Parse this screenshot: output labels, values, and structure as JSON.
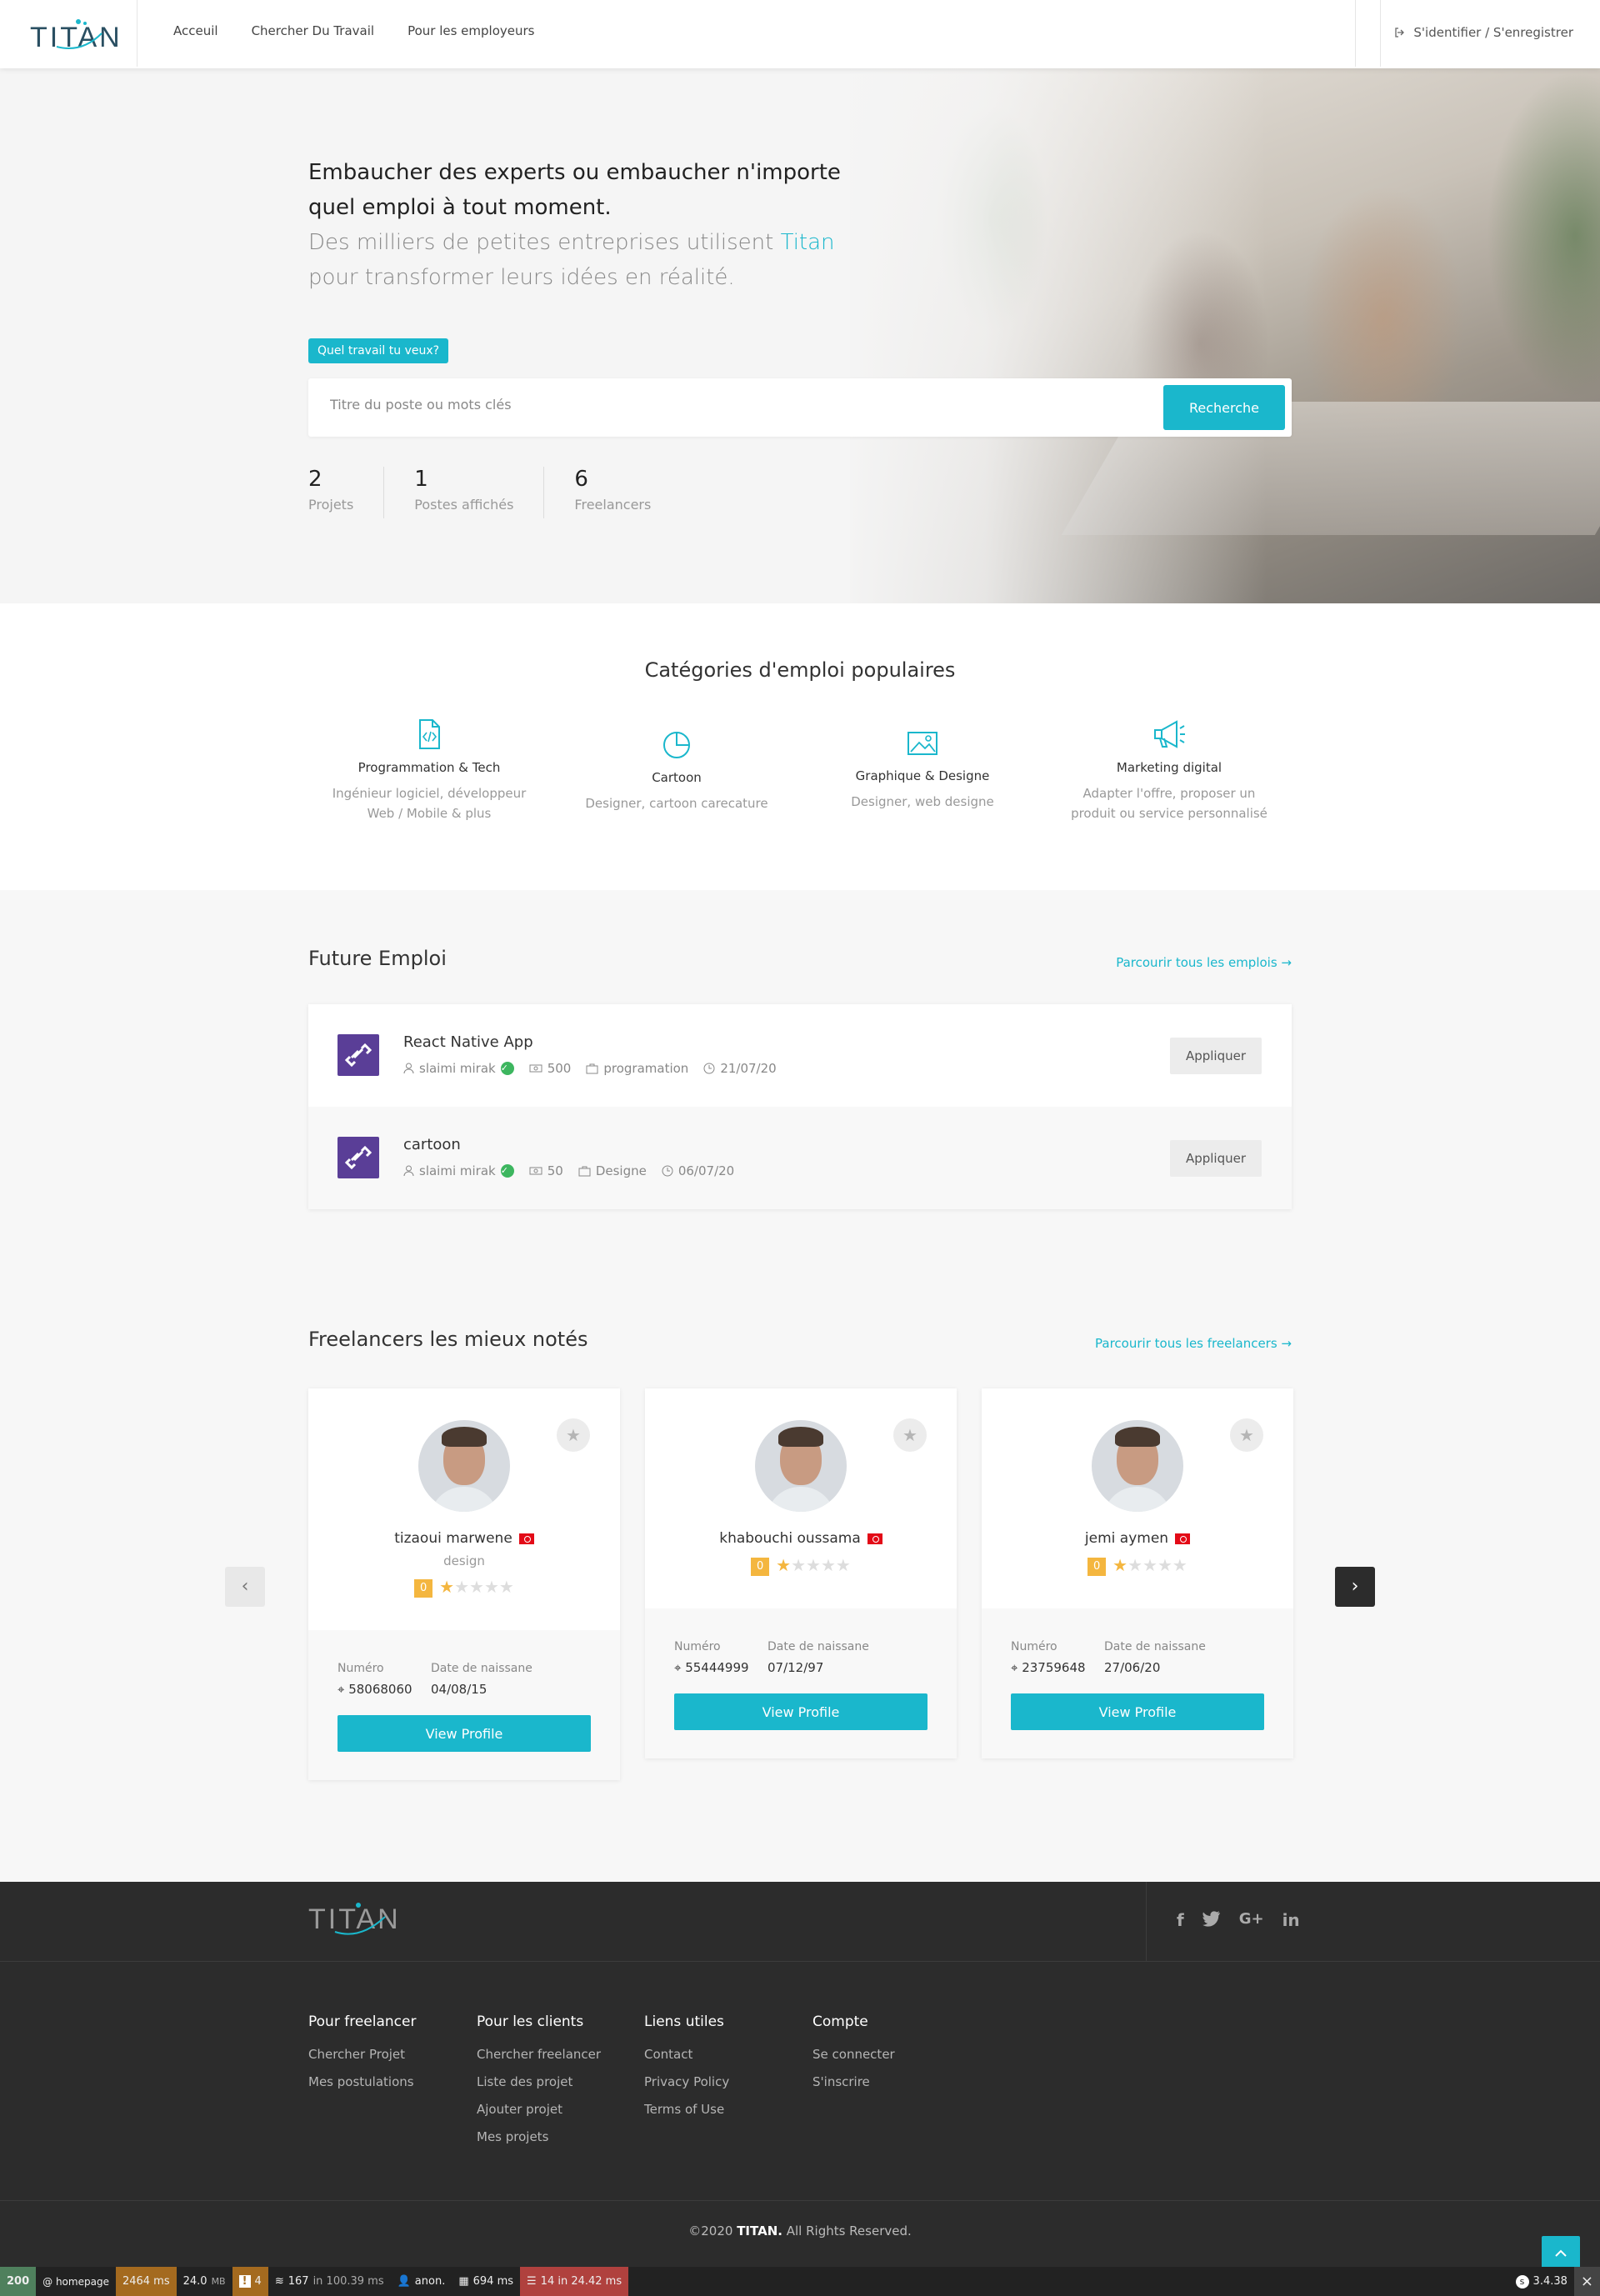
{
  "header": {
    "logo_text": "TITAN",
    "nav": [
      "Acceuil",
      "Chercher Du Travail",
      "Pour les employeurs"
    ],
    "signin": "S'identifier / S'enregistrer"
  },
  "hero": {
    "headline": "Embaucher des experts ou embaucher n'importe quel emploi à tout moment.",
    "sub_before": "Des milliers de petites entreprises utilisent",
    "sub_brand": "Titan",
    "sub_after": "pour transformer leurs idées en réalité.",
    "badge": "Quel travail tu veux?",
    "search_placeholder": "Titre du poste ou mots clés",
    "search_button": "Recherche",
    "stats": [
      {
        "value": "2",
        "label": "Projets"
      },
      {
        "value": "1",
        "label": "Postes affichés"
      },
      {
        "value": "6",
        "label": "Freelancers"
      }
    ]
  },
  "categories": {
    "title": "Catégories d'emploi populaires",
    "items": [
      {
        "title": "Programmation & Tech",
        "desc1": "Ingénieur logiciel, développeur",
        "desc2": "Web / Mobile & plus",
        "icon": "code-file-icon"
      },
      {
        "title": "Cartoon",
        "desc1": "Designer, cartoon carecature",
        "desc2": "",
        "icon": "pie-chart-icon"
      },
      {
        "title": "Graphique & Designe",
        "desc1": "Designer, web designe",
        "desc2": "",
        "icon": "image-icon"
      },
      {
        "title": "Marketing digital",
        "desc1": "Adapter l'offre, proposer un",
        "desc2": "produit ou service personnalisé",
        "icon": "megaphone-icon"
      }
    ]
  },
  "jobs": {
    "title": "Future Emploi",
    "link": "Parcourir tous les emplois →",
    "apply_label": "Appliquer",
    "items": [
      {
        "title": "React Native App",
        "user": "slaimi mirak",
        "budget": "500",
        "category": "programation",
        "date": "21/07/20"
      },
      {
        "title": "cartoon",
        "user": "slaimi mirak",
        "budget": "50",
        "category": "Designe",
        "date": "06/07/20"
      }
    ]
  },
  "freelancers": {
    "title": "Freelancers les mieux notés",
    "link": "Parcourir tous les freelancers →",
    "label_number": "Numéro",
    "label_birth": "Date de naissane",
    "button": "View Profile",
    "items": [
      {
        "name": "tizaoui marwene",
        "job": "design",
        "rating_count": "0",
        "stars": 1,
        "phone": "58068060",
        "birth": "04/08/15"
      },
      {
        "name": "khabouchi oussama",
        "job": "",
        "rating_count": "0",
        "stars": 1,
        "phone": "55444999",
        "birth": "07/12/97"
      },
      {
        "name": "jemi aymen",
        "job": "",
        "rating_count": "0",
        "stars": 1,
        "phone": "23759648",
        "birth": "27/06/20"
      }
    ]
  },
  "footer": {
    "columns": [
      {
        "title": "Pour freelancer",
        "links": [
          "Chercher Projet",
          "Mes postulations"
        ]
      },
      {
        "title": "Pour les clients",
        "links": [
          "Chercher freelancer",
          "Liste des projet",
          "Ajouter projet",
          "Mes projets"
        ]
      },
      {
        "title": "Liens utiles",
        "links": [
          "Contact",
          "Privacy Policy",
          "Terms of Use"
        ]
      },
      {
        "title": "Compte",
        "links": [
          "Se connecter",
          "S'inscrire"
        ]
      }
    ],
    "copy_prefix": "©2020",
    "copy_brand": "TITAN.",
    "copy_suffix": "All Rights Reserved."
  },
  "debug": {
    "status": "200",
    "route": "@ homepage",
    "time": "2464 ms",
    "memory": "24.0",
    "memory_unit": "MB",
    "warnings": "4",
    "queries": "167",
    "queries_time": "in 100.39 ms",
    "user": "anon.",
    "ms": "694 ms",
    "cache": "14 in 24.42 ms",
    "version": "3.4.38"
  },
  "colors": {
    "accent": "#1ab7cc",
    "job_icon": "#5a3e97",
    "star": "#f4b63f",
    "footer": "#2c2c2c"
  }
}
